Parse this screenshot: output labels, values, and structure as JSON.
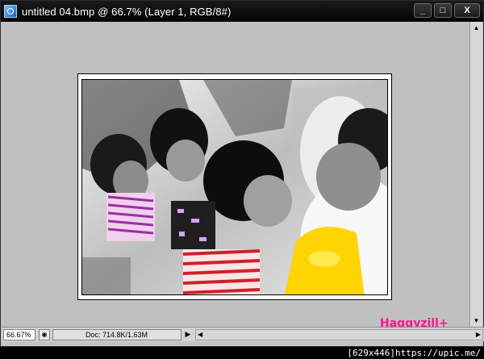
{
  "window": {
    "title": "untitled 04.bmp @ 66.7% (Layer 1, RGB/8#)",
    "minimize_label": "_",
    "maximize_label": "□",
    "close_label": "X"
  },
  "document": {
    "watermark": "Haqqyzill+"
  },
  "status": {
    "zoom": "66.67%",
    "doc_info": "Doc: 714.8K/1.63M"
  },
  "footer": {
    "text": "[629x446]https://upic.me/"
  },
  "icons": {
    "app": "photoshop-document-icon",
    "status_menu": "status-options-icon",
    "doc_menu": "right-arrow-icon"
  }
}
